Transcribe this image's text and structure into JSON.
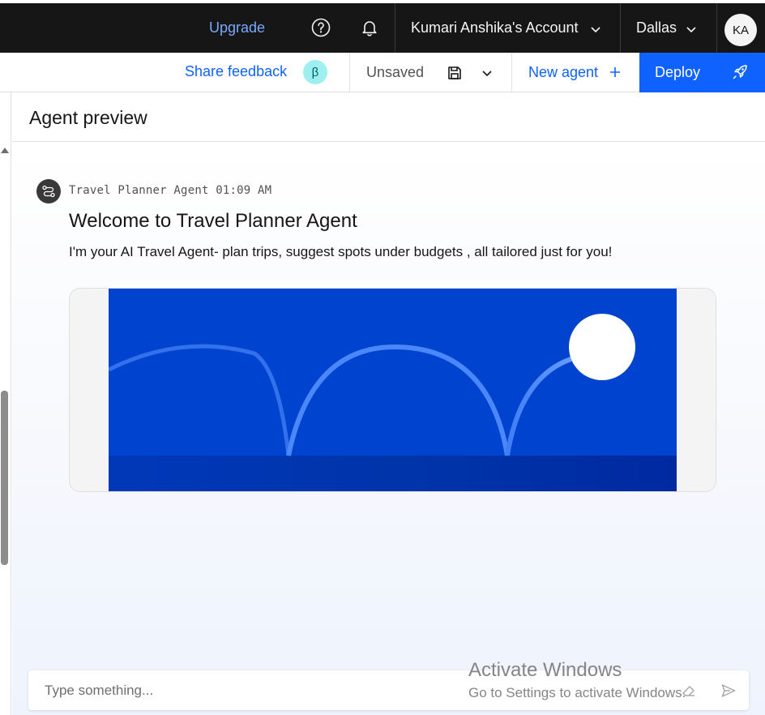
{
  "header": {
    "upgrade_label": "Upgrade",
    "account_label": "Kumari Anshika's Account",
    "region_label": "Dallas",
    "avatar_initials": "KA",
    "icons": [
      "help-icon",
      "notification-bell-icon",
      "chevron-down-icon"
    ]
  },
  "toolbar": {
    "feedback_label": "Share feedback",
    "beta_badge": "β",
    "status_label": "Unsaved",
    "new_agent_label": "New agent",
    "deploy_label": "Deploy",
    "icons": [
      "save-icon",
      "chevron-down-icon",
      "plus-icon",
      "rocket-icon"
    ]
  },
  "panel": {
    "title": "Agent preview"
  },
  "chat": {
    "message": {
      "sender": "Travel Planner Agent",
      "time": "01:09 AM",
      "heading": "Welcome to Travel Planner Agent",
      "body": "I'm your AI Travel Agent- plan trips, suggest spots under budgets , all tailored just for you!"
    },
    "input_placeholder": "Type something..."
  },
  "watermark": {
    "line1": "Activate Windows",
    "line2": "Go to Settings to activate Windows."
  },
  "colors": {
    "header_bg": "#161616",
    "accent": "#0f62fe",
    "link": "#78a9ff",
    "hero_blue": "#0043ce",
    "beta_bg": "#9ef0f0"
  }
}
